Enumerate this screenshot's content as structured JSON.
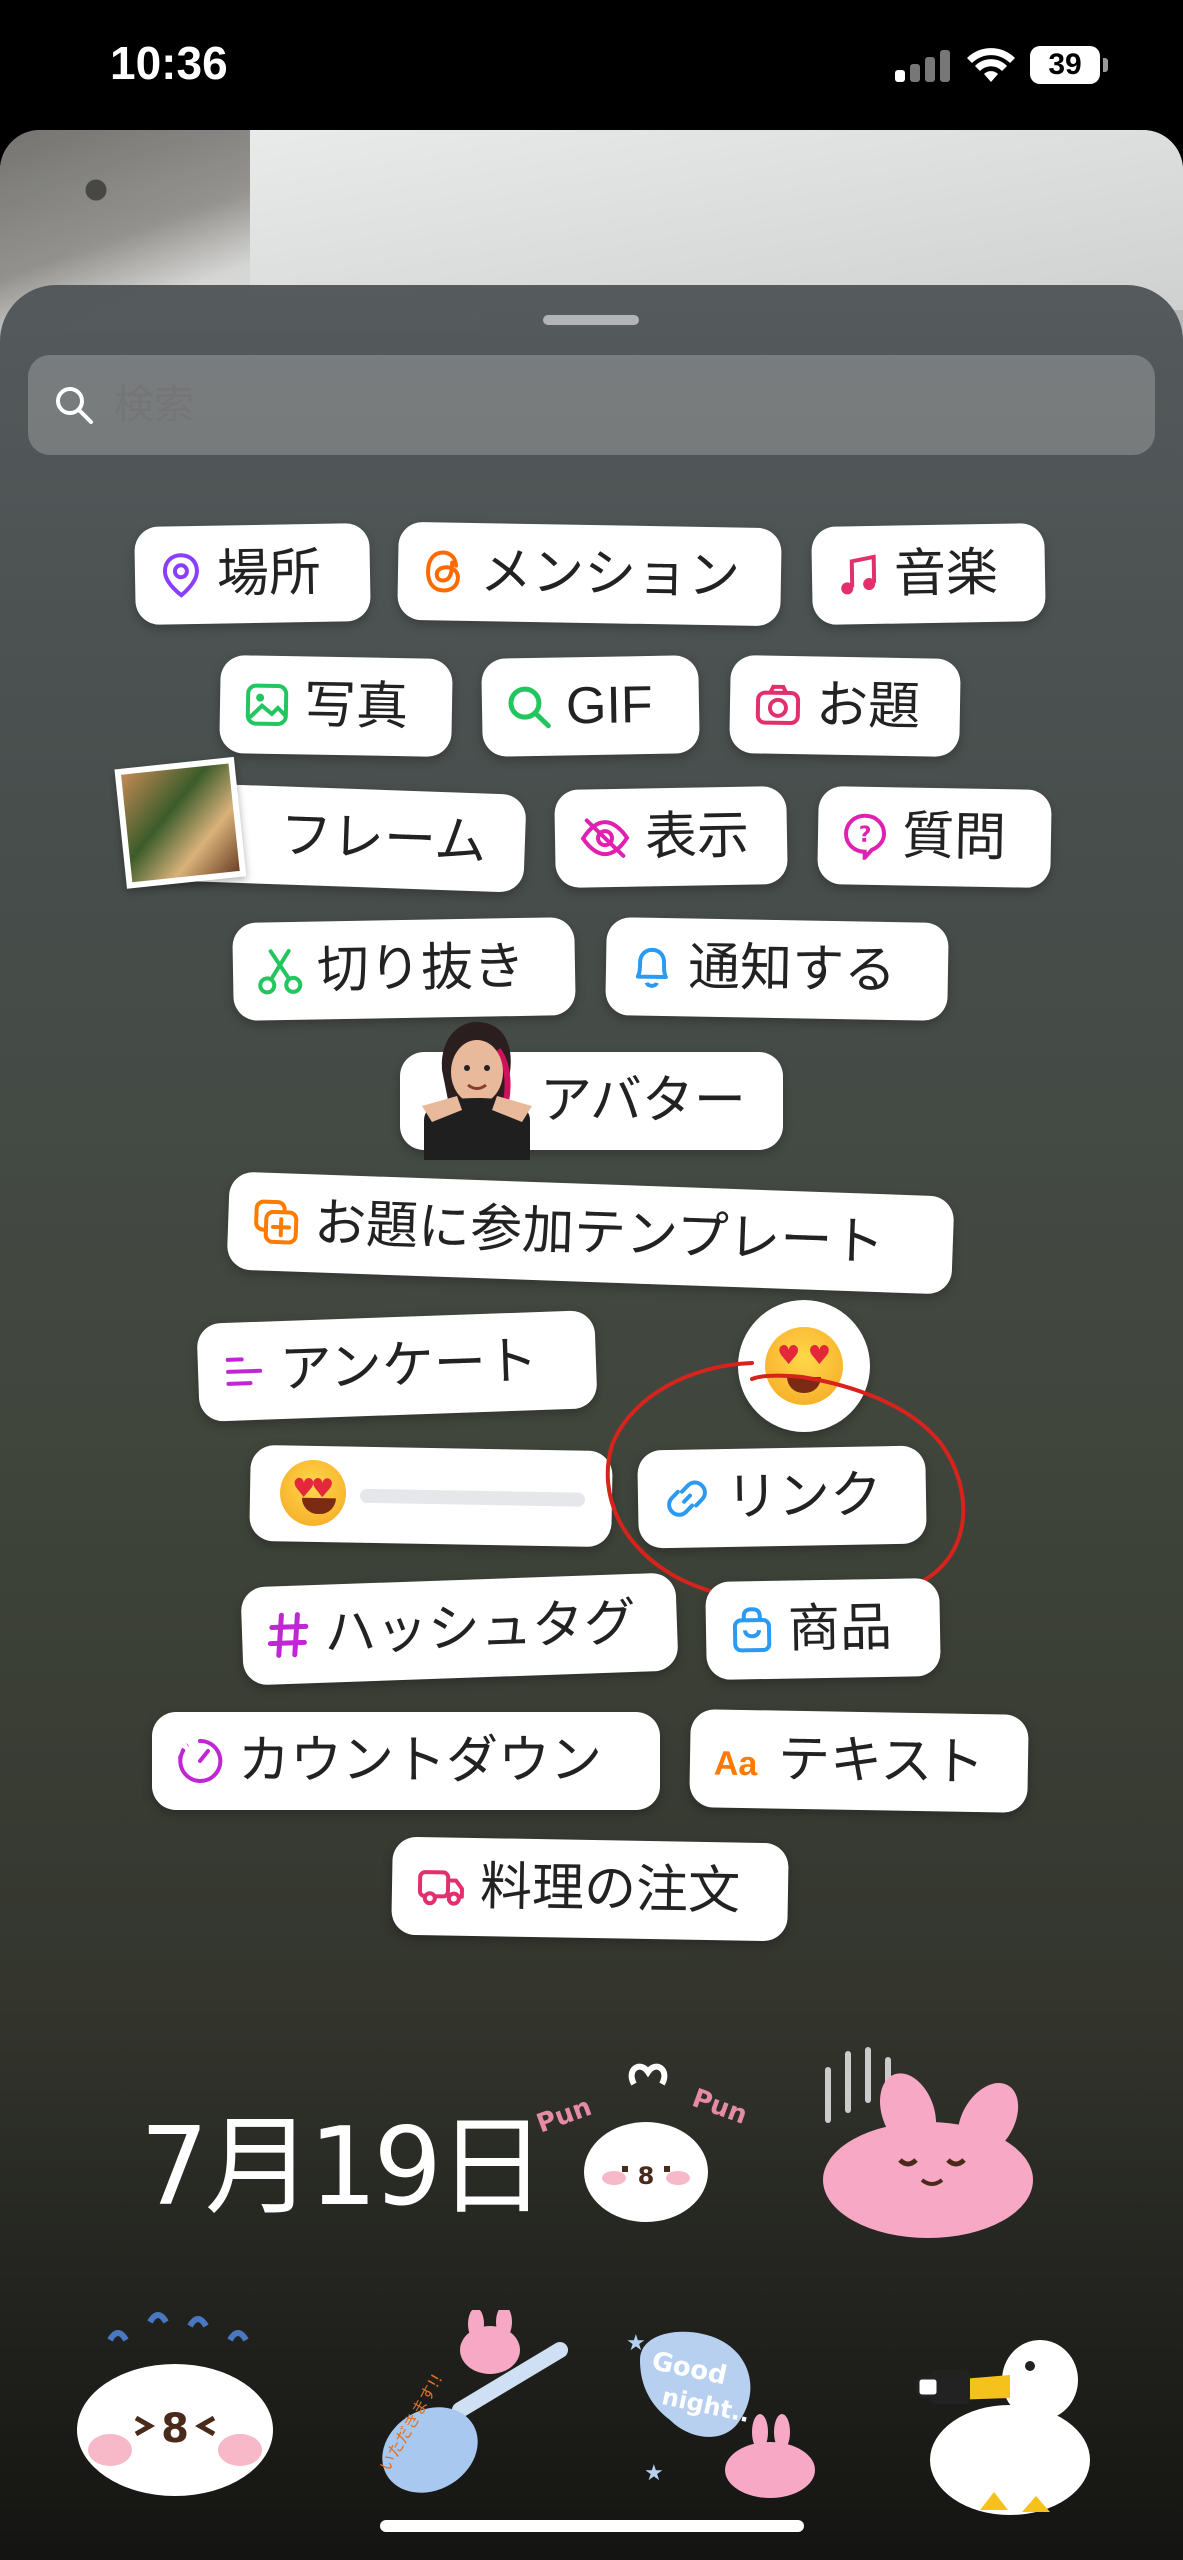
{
  "status": {
    "time": "10:36",
    "battery": "39"
  },
  "search": {
    "placeholder": "検索"
  },
  "stickers": {
    "location": "場所",
    "mention": "メンション",
    "music": "音楽",
    "photo": "写真",
    "gif": "GIF",
    "prompt": "お題",
    "frame": "フレーム",
    "reveal": "表示",
    "question": "質問",
    "cutout": "切り抜き",
    "notify": "通知する",
    "avatar": "アバター",
    "add_yours_template": "お題に参加テンプレート",
    "poll": "アンケート",
    "link": "リンク",
    "hashtag": "ハッシュタグ",
    "product": "商品",
    "countdown": "カウントダウン",
    "text": "テキスト",
    "food_order": "料理の注文"
  },
  "bottom": {
    "date": "7月19日"
  },
  "colors": {
    "accent_purple": "#8a3ffc",
    "accent_pink": "#e1306c",
    "accent_green": "#22c55e",
    "accent_blue": "#2b9af3",
    "accent_orange": "#ff7a00",
    "annotation_red": "#d8231c"
  }
}
